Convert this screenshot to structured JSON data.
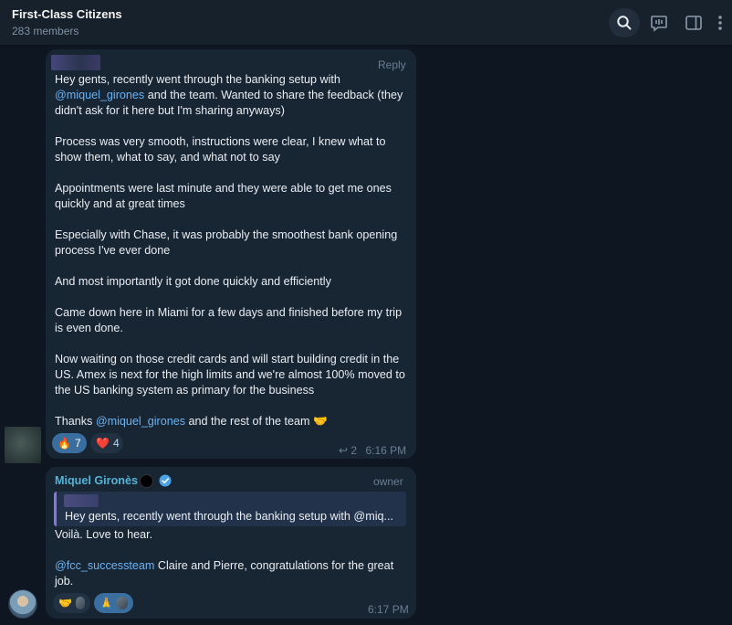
{
  "header": {
    "title": "First-Class Citizens",
    "members": "283 members"
  },
  "message1": {
    "reply_label": "Reply",
    "paragraphs": [
      {
        "pre": "Hey gents, recently went through the banking setup with ",
        "mention": "@miquel_girones",
        "post": " and the team. Wanted to share the feedback (they didn't ask for it here but I'm sharing anyways)"
      },
      {
        "text": "Process was very smooth, instructions were clear, I knew what to show them, what to say, and what not to say"
      },
      {
        "text": "Appointments were last minute and they were able to get me ones quickly and at great times"
      },
      {
        "text": "Especially with Chase, it was probably the smoothest bank opening process I've ever done"
      },
      {
        "text": "And most importantly it got done quickly and efficiently"
      },
      {
        "text": "Came down here in Miami for a few days and finished before my trip is even done."
      },
      {
        "text": "Now waiting on those credit cards and will start building credit in the US. Amex is next for the high limits and we're almost 100% moved to the US banking system as primary for the business"
      },
      {
        "pre": "Thanks ",
        "mention": "@miquel_girones",
        "post": " and the rest of the team 🤝"
      }
    ],
    "reactions": [
      {
        "emoji": "🔥",
        "count": "7"
      },
      {
        "emoji": "❤️",
        "count": "4"
      }
    ],
    "replies": "2",
    "time": "6:16 PM"
  },
  "message2": {
    "sender": "Miquel Gironès",
    "role": "owner",
    "quote_text": "Hey gents, recently went through the banking setup with @miq...",
    "line1": "Voilà. Love to hear.",
    "mention": "@fcc_successteam",
    "line2": " Claire and Pierre, congratulations for the great job.",
    "reactions": [
      {
        "emoji": "🤝"
      },
      {
        "emoji": "🙏"
      }
    ],
    "time": "6:17 PM"
  },
  "icons": {
    "search": "search-icon",
    "voice_chat": "voice-chat-icon",
    "sidebar": "sidebar-toggle-icon",
    "more": "more-vertical-icon",
    "reply_arrow": "reply-arrow-icon",
    "verified": "verified-badge-icon"
  },
  "colors": {
    "background": "#0e1621",
    "header": "#17212b",
    "bubble": "#182533",
    "mention": "#6ab3f3",
    "sender": "#54b3d6",
    "reaction_active": "#3a6e9f",
    "quote_bar": "#8774e1"
  }
}
